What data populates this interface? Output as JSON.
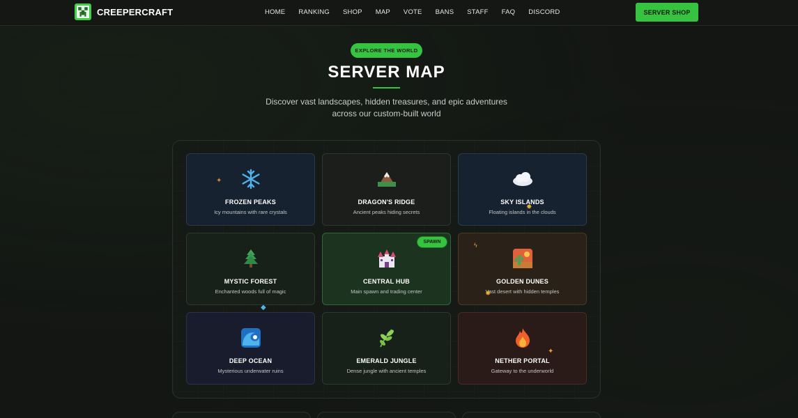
{
  "nav": {
    "brand": "CREEPERCRAFT",
    "links": [
      "HOME",
      "RANKING",
      "SHOP",
      "MAP",
      "VOTE",
      "BANS",
      "STAFF",
      "FAQ",
      "DISCORD"
    ],
    "cta": "SERVER SHOP"
  },
  "hero": {
    "badge": "EXPLORE THE WORLD",
    "title": "SERVER MAP",
    "subtitle": "Discover vast landscapes, hidden treasures, and epic adventures across our custom-built world"
  },
  "regions": [
    {
      "name": "FROZEN PEAKS",
      "desc": "Icy mountains with rare crystals",
      "icon": "snowflake-icon"
    },
    {
      "name": "DRAGON'S RIDGE",
      "desc": "Ancient peaks hiding secrets",
      "icon": "mountain-icon"
    },
    {
      "name": "SKY ISLANDS",
      "desc": "Floating islands in the clouds",
      "icon": "cloud-icon"
    },
    {
      "name": "MYSTIC FOREST",
      "desc": "Enchanted woods full of magic",
      "icon": "tree-icon"
    },
    {
      "name": "CENTRAL HUB",
      "desc": "Main spawn and trading center",
      "icon": "castle-icon",
      "badge": "SPAWN"
    },
    {
      "name": "GOLDEN DUNES",
      "desc": "Vast desert with hidden temples",
      "icon": "desert-icon"
    },
    {
      "name": "DEEP OCEAN",
      "desc": "Mysterious underwater ruins",
      "icon": "wave-icon"
    },
    {
      "name": "EMERALD JUNGLE",
      "desc": "Dense jungle with ancient temples",
      "icon": "leaf-icon"
    },
    {
      "name": "NETHER PORTAL",
      "desc": "Gateway to the underworld",
      "icon": "fire-icon"
    }
  ],
  "colors": {
    "accent": "#36c440"
  }
}
